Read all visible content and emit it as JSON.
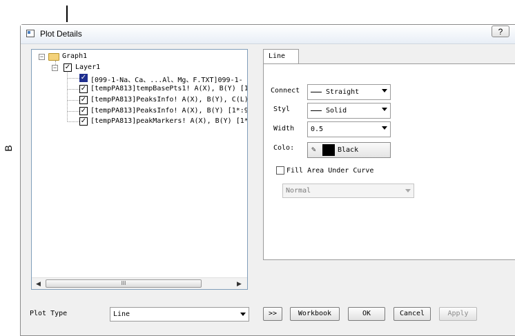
{
  "figure": {
    "side_label": "B"
  },
  "dialog": {
    "title": "Plot Details",
    "help_label": "?",
    "tree": {
      "root": "Graph1",
      "layer": "Layer1",
      "plots": [
        "[099-1-Na、Ca、...Al、Mg、F.TXT]099-1-",
        "[tempPA813]tempBasePts1! A(X), B(Y) [1",
        "[tempPA813]PeaksInfo! A(X), B(Y), C(L)",
        "[tempPA813]PeaksInfo! A(X), B(Y) [1*:9",
        "[tempPA813]peakMarkers! A(X), B(Y) [1*"
      ],
      "scroll_thumb": "III"
    },
    "tab": {
      "label": "Line"
    },
    "line": {
      "connect_label": "Connect",
      "connect_value": "Straight",
      "style_label": "Styl",
      "style_value": "Solid",
      "width_label": "Width",
      "width_value": "0.5",
      "color_label": "Colo:",
      "color_value": "Black",
      "color_hex": "#000000",
      "fill_label": "Fill Area Under Curve",
      "fill_mode": "Normal"
    },
    "footer": {
      "plot_type_label": "Plot Type",
      "plot_type_value": "Line",
      "expand_label": ">>",
      "workbook_label": "Workbook",
      "ok_label": "OK",
      "cancel_label": "Cancel",
      "apply_label": "Apply"
    }
  }
}
